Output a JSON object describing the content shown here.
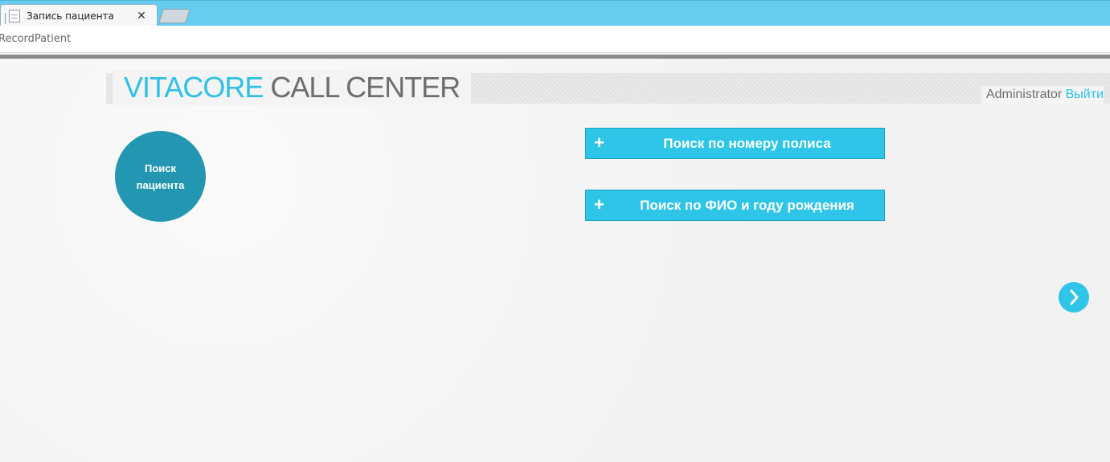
{
  "browser": {
    "tab_title": "Запись пациента",
    "tab_close": "✕",
    "address": "RecordPatient"
  },
  "header": {
    "logo_brand": "VITACORE",
    "logo_rest": "CALL CENTER",
    "user_name": "Administrator",
    "logout_label": "Выйти"
  },
  "main": {
    "step_circle_line1": "Поиск",
    "step_circle_line2": "пациента",
    "search_policy_label": "Поиск по номеру полиса",
    "search_fio_label": "Поиск по ФИО и году рождения",
    "plus_glyph": "+"
  },
  "colors": {
    "accent": "#2ec5e8",
    "circle": "#2396b1",
    "tabstrip": "#67cdee",
    "text_gray": "#6e6e6e"
  },
  "icons": {
    "next": "chevron-right-icon",
    "page": "page-icon",
    "close": "close-icon"
  }
}
